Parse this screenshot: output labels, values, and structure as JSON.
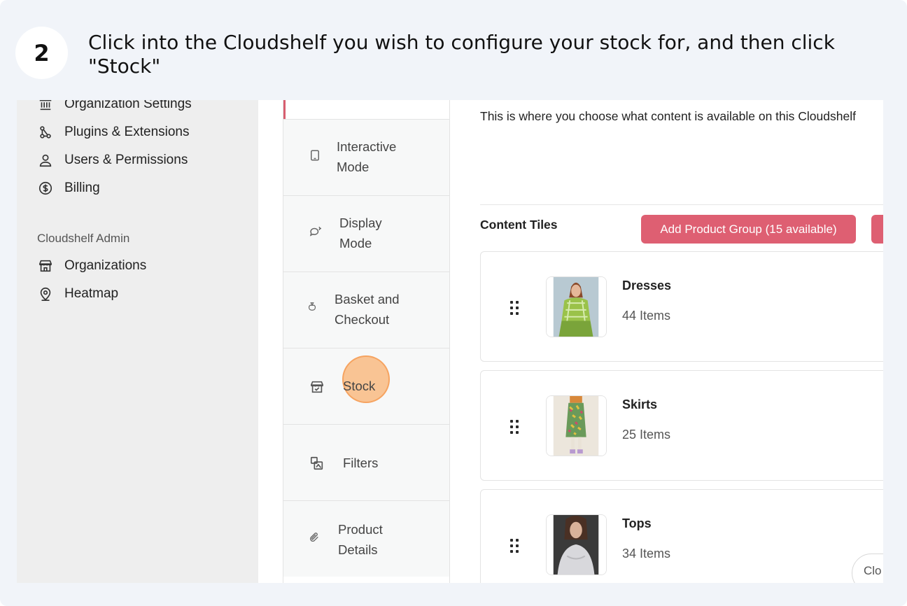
{
  "step": {
    "number": "2",
    "instruction": "Click into the Cloudshelf you wish to configure your stock for, and then click \"Stock\""
  },
  "admin_sidebar": {
    "items": [
      {
        "label": "Organization Settings",
        "icon": "bank-icon"
      },
      {
        "label": "Plugins & Extensions",
        "icon": "plugins-icon"
      },
      {
        "label": "Users & Permissions",
        "icon": "user-icon"
      },
      {
        "label": "Billing",
        "icon": "dollar-circle-icon"
      }
    ],
    "section_label": "Cloudshelf Admin",
    "admin_items": [
      {
        "label": "Organizations",
        "icon": "store-icon"
      },
      {
        "label": "Heatmap",
        "icon": "map-pin-icon"
      }
    ]
  },
  "settings_tabs": [
    {
      "line1": "Interactive",
      "line2": "Mode",
      "icon": "tablet-icon"
    },
    {
      "line1": "Display",
      "line2": "Mode",
      "icon": "chat-sparkle-icon"
    },
    {
      "line1": "Basket and",
      "line2": "Checkout",
      "icon": "money-bag-icon"
    },
    {
      "line1": "Stock",
      "line2": "",
      "icon": "store-check-icon"
    },
    {
      "line1": "Filters",
      "line2": "",
      "icon": "filter-shapes-icon"
    },
    {
      "line1": "Product",
      "line2": "Details",
      "icon": "paperclip-icon"
    }
  ],
  "main": {
    "description": "This is where you choose what content is available on this Cloudshelf",
    "content_tiles_title": "Content Tiles",
    "add_button_label": "Add Product Group (15 available)",
    "tiles": [
      {
        "name": "Dresses",
        "count": "44 Items"
      },
      {
        "name": "Skirts",
        "count": "25 Items"
      },
      {
        "name": "Tops",
        "count": "34 Items"
      }
    ],
    "floating_label": "Clo"
  },
  "colors": {
    "accent": "#de5f72",
    "highlight": "#f9b06e",
    "background": "#f1f4f9"
  }
}
